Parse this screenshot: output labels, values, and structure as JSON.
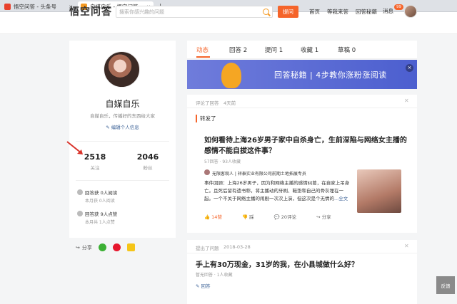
{
  "browser": {
    "tabs": [
      {
        "title": "悟空问答 - 头条号",
        "active": false
      },
      {
        "title": "自媒自乐 - 悟空问答",
        "active": true
      }
    ],
    "new_tab": "+"
  },
  "header": {
    "logo": "悟空问答",
    "search_placeholder": "搜索你感兴趣的问题",
    "ask_label": "提问",
    "nav": [
      "首页",
      "等我来答",
      "回答秘籍",
      "消息"
    ],
    "message_badge": "99"
  },
  "profile": {
    "name": "自媒自乐",
    "bio": "自媒自乐，传播好的东西给大家",
    "edit_label": "编辑个人信息",
    "following": {
      "value": "2518",
      "label": "关注"
    },
    "followers": {
      "value": "2046",
      "label": "粉丝"
    },
    "achievements": [
      {
        "title": "回答获 0人阅读",
        "sub": "本月获 0人阅读"
      },
      {
        "title": "回答获 9人点赞",
        "sub": "本月共 1人点赞"
      }
    ],
    "share_label": "分享"
  },
  "main_tabs": [
    {
      "label": "动态",
      "active": true
    },
    {
      "label": "回答 2",
      "active": false
    },
    {
      "label": "提问 1",
      "active": false
    },
    {
      "label": "收藏 1",
      "active": false
    },
    {
      "label": "草稿 0",
      "active": false
    }
  ],
  "banner": {
    "text": "回答秘籍 | 4步教你涨粉涨阅读",
    "close": "×"
  },
  "feed": [
    {
      "action": "评论了回答",
      "time": "4天前",
      "repost_label": "转发了",
      "question_line1": "如何看待上海26岁男子家中自杀身亡，生前深陷与网络女主播的",
      "question_line2": "感情不能自拔这件事？",
      "question_meta": "57回答 · 93人收藏",
      "answer_author": "无限客观人 | 祥泰实业有限公司前期土地拓展专员",
      "answer_text": "事件回顾：上海26岁男子，因为和网络主播的感情纠葛，在自家上吊身亡。且死后留有遗书称，将主播动的牙刷、鞋垫和自己的骨灰埋在一起。一个不关于网络主播的闹剧一次次上演，但这次是个无情的",
      "more_label": "...全文",
      "actions": {
        "likes": "14赞",
        "dislike": "踩",
        "comments": "20评论",
        "share": "分享"
      }
    },
    {
      "action": "提出了问题",
      "time": "2018-03-28",
      "question": "手上有30万现金，31岁的我，在小县城做什么好？",
      "question_meta": "暂无回答 · 1人收藏",
      "answer_link": "回答"
    }
  ],
  "feedback_label": "反馈",
  "colors": {
    "accent": "#f5642a",
    "link": "#406599",
    "banner": "#5c6bd6"
  }
}
